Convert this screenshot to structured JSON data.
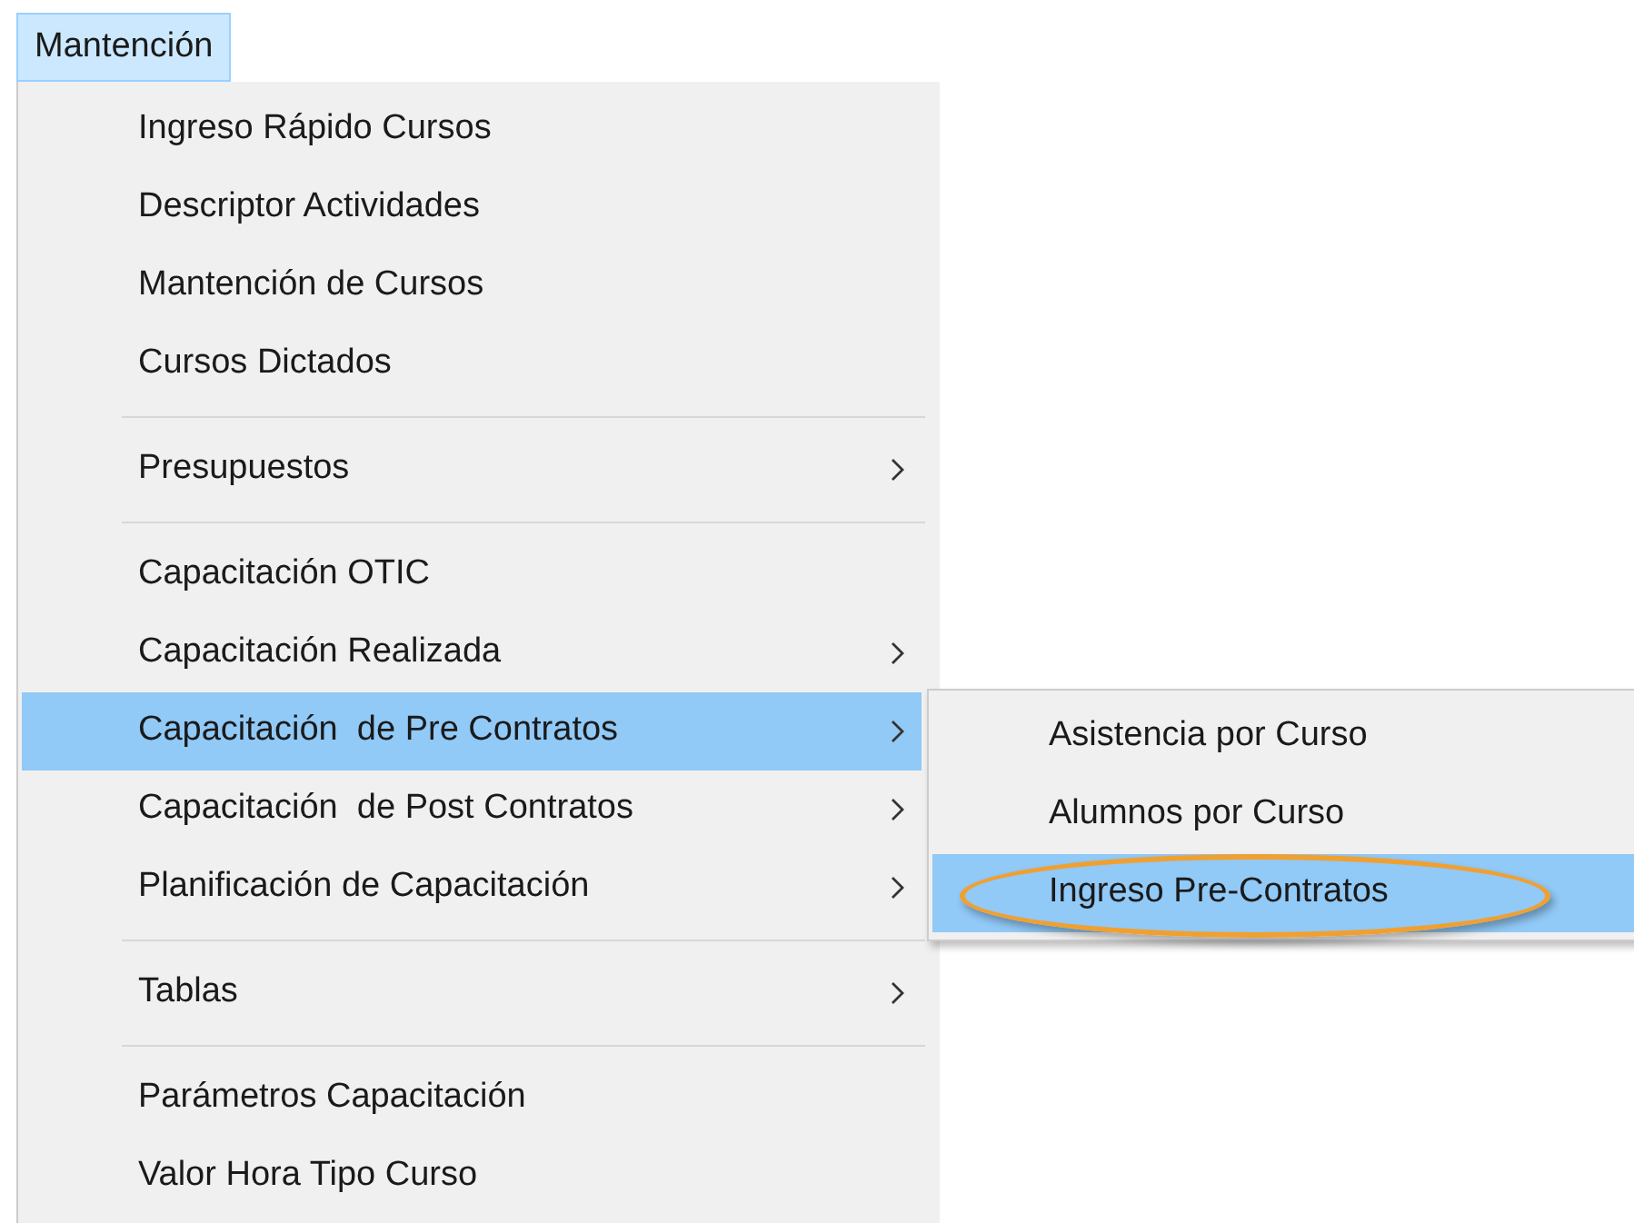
{
  "menubar": [
    {
      "label": "Mantención",
      "selected": true
    }
  ],
  "menu": {
    "items": [
      {
        "kind": "item",
        "label": "Ingreso Rápido Cursos",
        "has_submenu": false,
        "selected": false
      },
      {
        "kind": "item",
        "label": "Descriptor Actividades",
        "has_submenu": false,
        "selected": false
      },
      {
        "kind": "item",
        "label": "Mantención de Cursos",
        "has_submenu": false,
        "selected": false
      },
      {
        "kind": "item",
        "label": "Cursos Dictados",
        "has_submenu": false,
        "selected": false
      },
      {
        "kind": "separator"
      },
      {
        "kind": "item",
        "label": "Presupuestos",
        "has_submenu": true,
        "selected": false
      },
      {
        "kind": "separator"
      },
      {
        "kind": "item",
        "label": "Capacitación OTIC",
        "has_submenu": false,
        "selected": false
      },
      {
        "kind": "item",
        "label": "Capacitación Realizada",
        "has_submenu": true,
        "selected": false
      },
      {
        "kind": "item",
        "label": "Capacitación  de Pre Contratos",
        "has_submenu": true,
        "selected": true
      },
      {
        "kind": "item",
        "label": "Capacitación  de Post Contratos",
        "has_submenu": true,
        "selected": false
      },
      {
        "kind": "item",
        "label": "Planificación de Capacitación",
        "has_submenu": true,
        "selected": false
      },
      {
        "kind": "separator"
      },
      {
        "kind": "item",
        "label": "Tablas",
        "has_submenu": true,
        "selected": false
      },
      {
        "kind": "separator"
      },
      {
        "kind": "item",
        "label": "Parámetros Capacitación",
        "has_submenu": false,
        "selected": false
      },
      {
        "kind": "item",
        "label": "Valor Hora Tipo Curso",
        "has_submenu": false,
        "selected": false
      }
    ]
  },
  "submenu": {
    "items": [
      {
        "label": "Asistencia por Curso",
        "selected": false,
        "circled": false
      },
      {
        "label": "Alumnos por Curso",
        "selected": false,
        "circled": false
      },
      {
        "label": "Ingreso Pre-Contratos",
        "selected": true,
        "circled": true
      }
    ]
  }
}
